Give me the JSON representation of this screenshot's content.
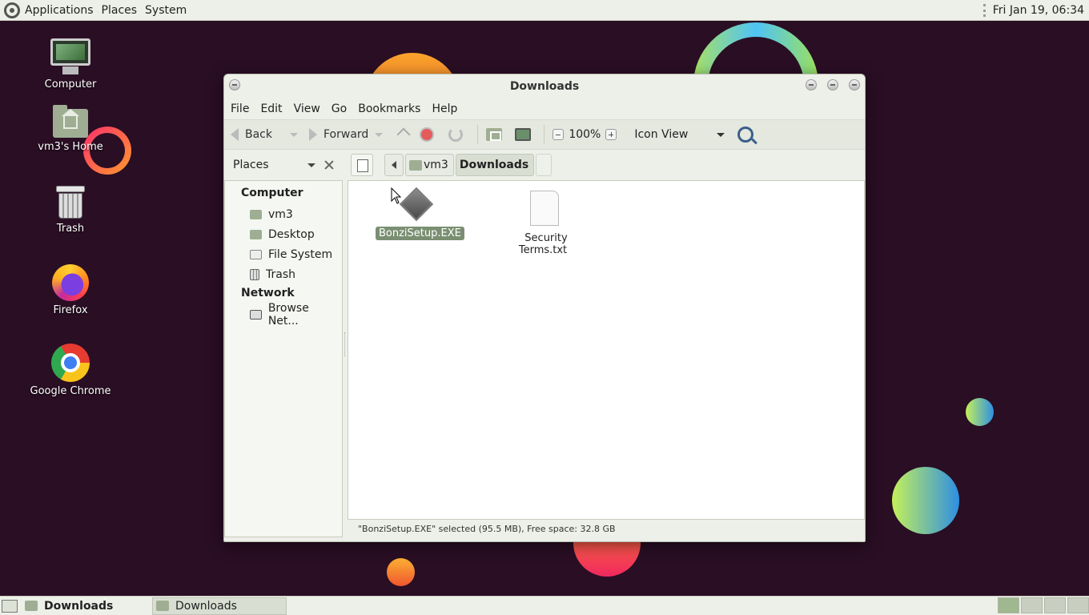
{
  "top_panel": {
    "menus": [
      "Applications",
      "Places",
      "System"
    ],
    "clock": "Fri Jan 19, 06:34"
  },
  "desktop_icons": [
    {
      "label": "Computer",
      "icon": "computer-icon"
    },
    {
      "label": "vm3's Home",
      "icon": "home-folder-icon"
    },
    {
      "label": "Trash",
      "icon": "trash-icon"
    },
    {
      "label": "Firefox",
      "icon": "firefox-icon"
    },
    {
      "label": "Google Chrome",
      "icon": "chrome-icon"
    }
  ],
  "window": {
    "title": "Downloads",
    "menu": [
      "File",
      "Edit",
      "View",
      "Go",
      "Bookmarks",
      "Help"
    ],
    "toolbar": {
      "back": "Back",
      "forward": "Forward",
      "zoom": "100%",
      "view_mode": "Icon View"
    },
    "places_header": "Places",
    "breadcrumbs": [
      "vm3",
      "Downloads"
    ],
    "sidebar": {
      "computer_header": "Computer",
      "computer_items": [
        "vm3",
        "Desktop",
        "File System",
        "Trash"
      ],
      "network_header": "Network",
      "network_items": [
        "Browse Net..."
      ]
    },
    "files": [
      {
        "name": "BonziSetup.EXE",
        "selected": true,
        "icon": "executable-icon"
      },
      {
        "name": "Security Terms.txt",
        "selected": false,
        "icon": "text-file-icon"
      }
    ],
    "status": "\"BonziSetup.EXE\" selected (95.5 MB), Free space: 32.8 GB"
  },
  "bottom_panel": {
    "tasks": [
      "Downloads",
      "Downloads"
    ]
  }
}
